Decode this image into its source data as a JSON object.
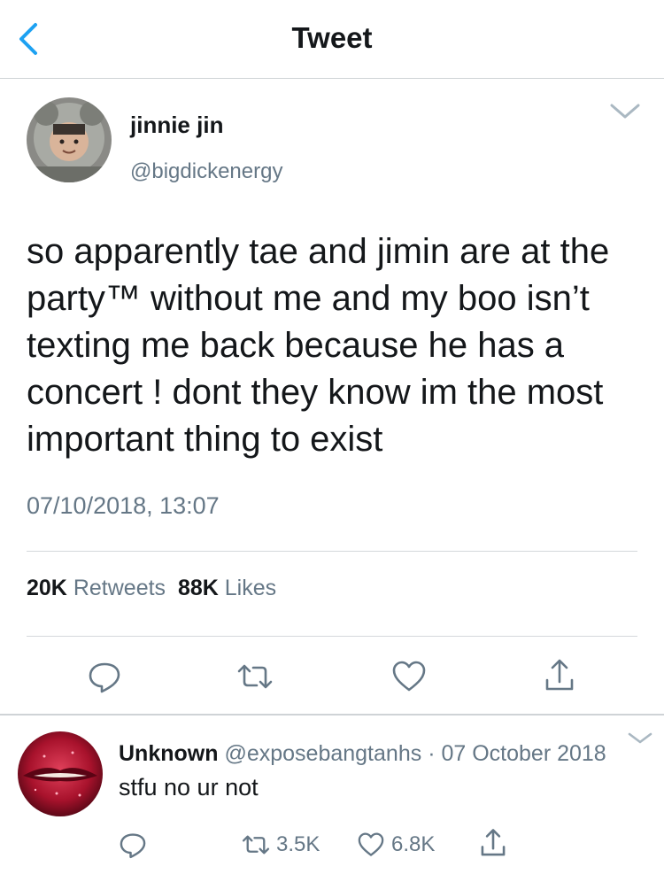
{
  "header": {
    "title": "Tweet",
    "back_icon": "chevron-left-icon"
  },
  "tweet": {
    "author": {
      "display_name": "jinnie jin",
      "handle": "@bigdickenergy"
    },
    "text": "so apparently tae and jimin are at the party™ without me and my boo isn’t texting me back because he has a concert ! dont they know im the most important thing to exist",
    "timestamp": "07/10/2018, 13:07",
    "stats": {
      "retweets_count": "20K",
      "retweets_label": "Retweets",
      "likes_count": "88K",
      "likes_label": "Likes"
    },
    "actions": [
      "reply-icon",
      "retweet-icon",
      "heart-icon",
      "share-icon"
    ]
  },
  "reply": {
    "display_name": "Unknown",
    "handle": "@exposebangtanhs",
    "separator": "·",
    "date": "07 October 2018",
    "text": "stfu no ur not",
    "retweets": "3.5K",
    "likes": "6.8K"
  },
  "colors": {
    "accent": "#1da1f2",
    "secondary_text": "#657786",
    "primary_text": "#14171a",
    "divider": "#cfd3d6"
  }
}
